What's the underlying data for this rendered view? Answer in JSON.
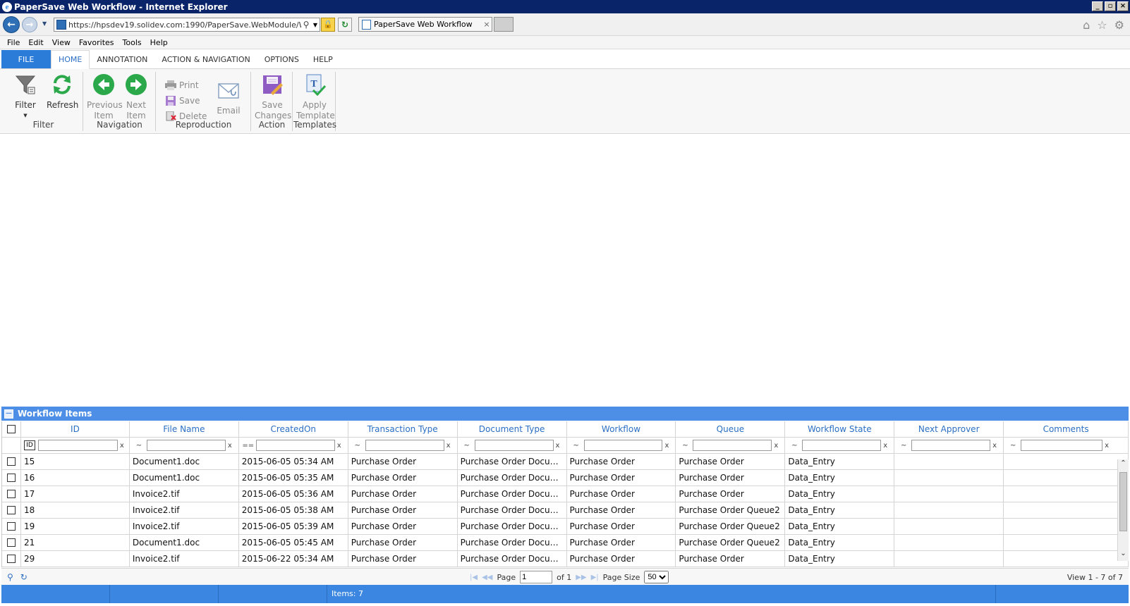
{
  "window": {
    "title": "PaperSave Web Workflow - Internet Explorer",
    "controls": [
      "_",
      "▫",
      "×"
    ]
  },
  "browser": {
    "address": "https://hpsdev19.solidev.com:1990/PaperSave.WebModule/WorkFl",
    "tab_label": "PaperSave Web Workflow",
    "tab_close": "×"
  },
  "menu": {
    "items": [
      "File",
      "Edit",
      "View",
      "Favorites",
      "Tools",
      "Help"
    ]
  },
  "ribbon": {
    "tabs": [
      "FILE",
      "HOME",
      "ANNOTATION",
      "ACTION & NAVIGATION",
      "OPTIONS",
      "HELP"
    ],
    "active_tab": "HOME",
    "groups": {
      "filter": {
        "label": "Filter",
        "filter_btn": "Filter",
        "refresh_btn": "Refresh"
      },
      "navigation": {
        "label": "Navigation",
        "prev_btn_1": "Previous",
        "prev_btn_2": "Item",
        "next_btn_1": "Next",
        "next_btn_2": "Item"
      },
      "reproduction": {
        "label": "Reproduction",
        "print": "Print",
        "save": "Save",
        "delete": "Delete",
        "email": "Email"
      },
      "action": {
        "label": "Action",
        "save_changes_1": "Save",
        "save_changes_2": "Changes"
      },
      "templates": {
        "label": "Templates",
        "apply_1": "Apply",
        "apply_2": "Template"
      }
    }
  },
  "panel": {
    "title": "Workflow Items"
  },
  "grid": {
    "columns": [
      "ID",
      "File Name",
      "CreatedOn",
      "Transaction Type",
      "Document Type",
      "Workflow",
      "Queue",
      "Workflow State",
      "Next Approver",
      "Comments"
    ],
    "filter_ops": [
      "ID",
      "~",
      "==",
      "~",
      "~",
      "~",
      "~",
      "~",
      "~",
      "~"
    ],
    "filter_clear": "x",
    "rows": [
      [
        "15",
        "Document1.doc",
        "2015-06-05 05:34 AM",
        "Purchase Order",
        "Purchase Order Document...",
        "Purchase Order",
        "Purchase Order",
        "Data_Entry",
        "",
        ""
      ],
      [
        "16",
        "Document1.doc",
        "2015-06-05 05:35 AM",
        "Purchase Order",
        "Purchase Order Document...",
        "Purchase Order",
        "Purchase Order",
        "Data_Entry",
        "",
        ""
      ],
      [
        "17",
        "Invoice2.tif",
        "2015-06-05 05:36 AM",
        "Purchase Order",
        "Purchase Order Document...",
        "Purchase Order",
        "Purchase Order",
        "Data_Entry",
        "",
        ""
      ],
      [
        "18",
        "Invoice2.tif",
        "2015-06-05 05:38 AM",
        "Purchase Order",
        "Purchase Order Document...",
        "Purchase Order",
        "Purchase Order Queue2",
        "Data_Entry",
        "",
        ""
      ],
      [
        "19",
        "Invoice2.tif",
        "2015-06-05 05:39 AM",
        "Purchase Order",
        "Purchase Order Document...",
        "Purchase Order",
        "Purchase Order Queue2",
        "Data_Entry",
        "",
        ""
      ],
      [
        "21",
        "Document1.doc",
        "2015-06-05 05:45 AM",
        "Purchase Order",
        "Purchase Order Document...",
        "Purchase Order",
        "Purchase Order Queue2",
        "Data_Entry",
        "",
        ""
      ],
      [
        "29",
        "Invoice2.tif",
        "2015-06-22 05:34 AM",
        "Purchase Order",
        "Purchase Order Document...",
        "Purchase Order",
        "Purchase Order",
        "Data_Entry",
        "",
        ""
      ]
    ]
  },
  "pager": {
    "page_label": "Page",
    "page_value": "1",
    "of_label": "of 1",
    "page_size_label": "Page Size",
    "page_size_value": "50",
    "view_text": "View 1 - 7 of 7"
  },
  "status": {
    "items_text": "Items: 7"
  }
}
